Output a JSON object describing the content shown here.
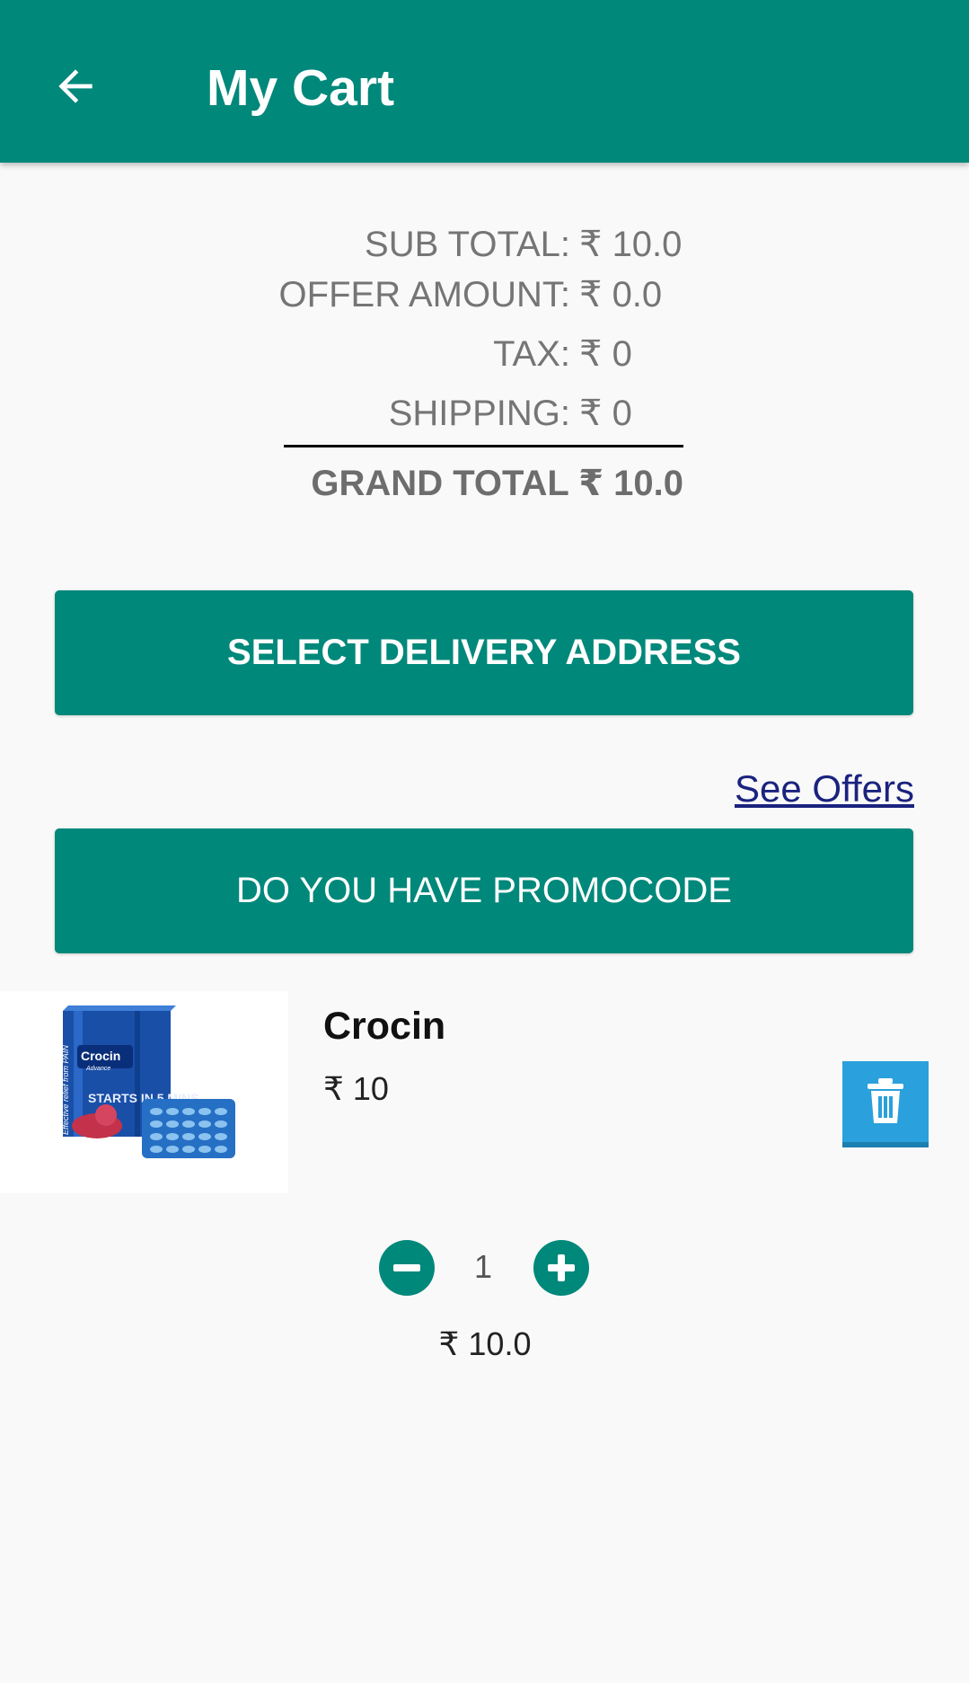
{
  "header": {
    "title": "My Cart",
    "back_icon": "arrow-left-icon"
  },
  "summary": {
    "sub_total_label": "SUB TOTAL:",
    "sub_total_value": "₹ 10.0",
    "offer_amount_label": "OFFER AMOUNT:",
    "offer_amount_value": "₹ 0.0",
    "tax_label": "TAX:",
    "tax_value": "₹ 0",
    "shipping_label": "SHIPPING:",
    "shipping_value": "₹ 0",
    "grand_total": "GRAND TOTAL ₹ 10.0"
  },
  "actions": {
    "select_address": "SELECT DELIVERY ADDRESS",
    "see_offers": "See Offers",
    "promocode": "DO YOU HAVE PROMOCODE"
  },
  "cart_item": {
    "name": "Crocin",
    "price": "₹ 10",
    "quantity": "1",
    "line_total": "₹ 10.0",
    "delete_icon": "trash-icon",
    "image_text": {
      "brand": "Crocin",
      "variant": "Advance",
      "tagline": "STARTS IN 5 MINS",
      "side": "Effective relief from PAIN"
    }
  },
  "colors": {
    "primary": "#00887a",
    "delete": "#2aa0dc",
    "link": "#1a237e",
    "background": "#f9f9f9"
  }
}
